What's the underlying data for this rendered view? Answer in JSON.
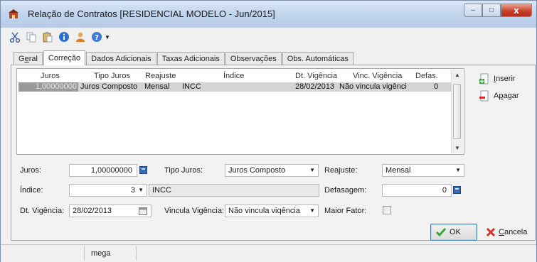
{
  "window": {
    "title": "Relação de Contratos [RESIDENCIAL MODELO - Jun/2015]",
    "buttons": {
      "minimize": "–",
      "maximize": "□",
      "close": "x"
    }
  },
  "toolbar": {
    "icons": [
      "scissors-icon",
      "copy-icon",
      "paste-icon",
      "info-icon",
      "user-icon",
      "help-icon",
      "dropdown-arrow-icon"
    ]
  },
  "tabs": [
    {
      "label": "Geral",
      "accel": "e"
    },
    {
      "label": "Correção",
      "active": true
    },
    {
      "label": "Dados Adicionais"
    },
    {
      "label": "Taxas Adicionais"
    },
    {
      "label": "Observações"
    },
    {
      "label": "Obs. Automáticas"
    }
  ],
  "grid": {
    "columns": [
      "Juros",
      "Tipo Juros",
      "Reajuste",
      "Índice",
      "Dt. Vigência",
      "Vinc. Vigência",
      "Defas."
    ],
    "rows": [
      {
        "juros": "1,00000000",
        "tipo_juros": "Juros Composto",
        "reajuste": "Mensal",
        "indice": "INCC",
        "dt_vigencia": "28/02/2013",
        "vinc_vigencia": "Não vincula vigênci",
        "defas": "0"
      }
    ]
  },
  "side_buttons": {
    "insert": "Inserir",
    "delete": "Apagar"
  },
  "form": {
    "juros_label": "Juros:",
    "juros_value": "1,00000000",
    "tipo_juros_label": "Tipo Juros:",
    "tipo_juros_value": "Juros Composto",
    "reajuste_label": "Reajuste:",
    "reajuste_value": "Mensal",
    "indice_label": "Índice:",
    "indice_code": "3",
    "indice_name": "INCC",
    "defasagem_label": "Defasagem:",
    "defasagem_value": "0",
    "dt_vigencia_label": "Dt. Vigência:",
    "dt_vigencia_value": "28/02/2013",
    "vincula_vigencia_label": "Vincula Vigência:",
    "vincula_vigencia_value": "Não vincula viqência",
    "maior_fator_label": "Maior Fator:"
  },
  "dialog_buttons": {
    "ok": "OK",
    "cancel": "Cancela"
  },
  "status_bar": {
    "user": "mega"
  },
  "colors": {
    "title_gradient_top": "#dbe7f6",
    "close_button": "#c8422a",
    "selected_row": "#d4d4d4",
    "ok_check": "#3aa53a",
    "cancel_x": "#d3322b"
  }
}
